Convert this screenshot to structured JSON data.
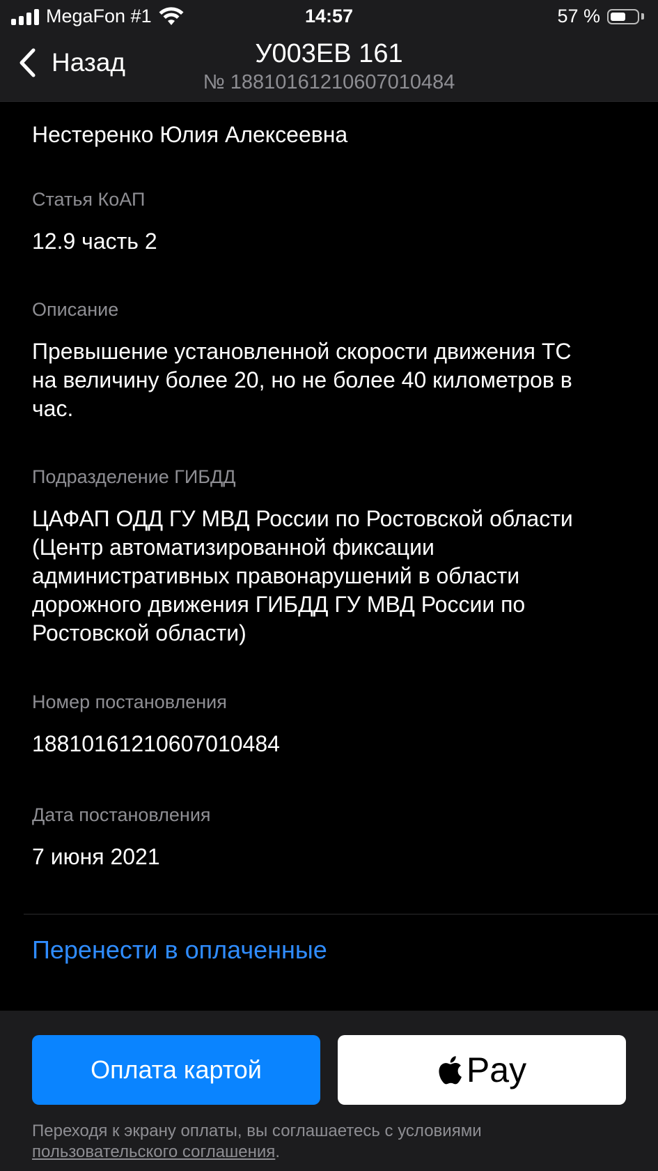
{
  "status_bar": {
    "carrier": "MegaFon #1",
    "time": "14:57",
    "battery_percent": "57 %",
    "battery_level": 0.57,
    "signal_icon": "signal-icon",
    "wifi_icon": "wifi-icon",
    "battery_icon": "battery-icon"
  },
  "nav": {
    "back_label": "Назад",
    "back_icon": "chevron-left-icon",
    "title": "У003ЕВ 161",
    "subtitle": "№ 18810161210607010484"
  },
  "details": {
    "owner": "Нестеренко Юлия Алексеевна",
    "fields": [
      {
        "label": "Статья КоАП",
        "value": "12.9 часть 2"
      },
      {
        "label": "Описание",
        "value": "Превышение установленной скорости движения ТС на величину более 20, но не более 40 километров в час."
      },
      {
        "label": "Подразделение ГИБДД",
        "value": "ЦАФАП ОДД ГУ МВД России по Ростовской области (Центр автоматизированной фиксации административных правонарушений в области дорожного движения ГИБДД ГУ МВД России по Ростовской области)"
      },
      {
        "label": "Номер постановления",
        "value": "18810161210607010484"
      },
      {
        "label": "Дата постановления",
        "value": "7 июня 2021"
      }
    ]
  },
  "actions": {
    "move_to_paid": "Перенести в оплаченные"
  },
  "payment": {
    "card_button": "Оплата картой",
    "apple_pay_text": "Pay",
    "apple_icon": "apple-logo-icon",
    "terms_text": "Переходя к экрану оплаты, вы соглашаетесь с условиями ",
    "terms_link": "пользовательского соглашения",
    "terms_end": "."
  },
  "colors": {
    "background": "#000000",
    "bar_background": "#1c1c1e",
    "label_gray": "#8e8e93",
    "link_blue": "#2f8cff",
    "button_blue": "#0a84ff"
  }
}
